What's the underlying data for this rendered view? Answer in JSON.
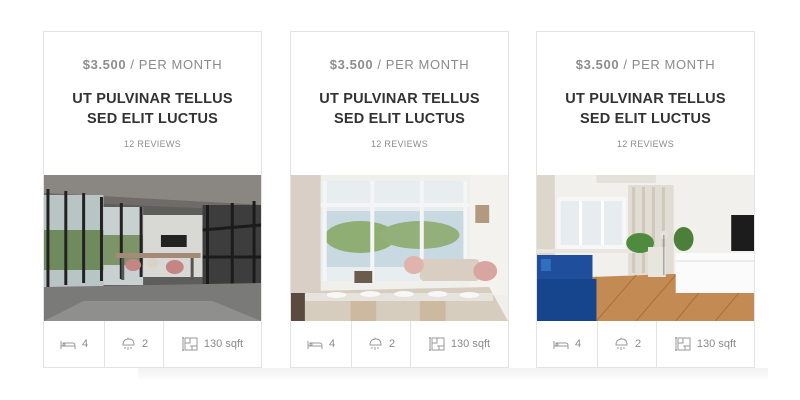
{
  "listings": [
    {
      "price_amount": "$3.500",
      "price_period": " / PER MONTH",
      "title_line1": "UT PULVINAR TELLUS",
      "title_line2": "SED ELIT LUCTUS",
      "reviews": "12 REVIEWS",
      "photo": "loft-office-interior",
      "beds": "4",
      "baths": "2",
      "area": "130 sqft"
    },
    {
      "price_amount": "$3.500",
      "price_period": " / PER MONTH",
      "title_line1": "UT PULVINAR TELLUS",
      "title_line2": "SED ELIT LUCTUS",
      "reviews": "12 REVIEWS",
      "photo": "dining-living-room",
      "beds": "4",
      "baths": "2",
      "area": "130 sqft"
    },
    {
      "price_amount": "$3.500",
      "price_period": " / PER MONTH",
      "title_line1": "UT PULVINAR TELLUS",
      "title_line2": "SED ELIT LUCTUS",
      "reviews": "12 REVIEWS",
      "photo": "living-room-blue-sofa",
      "beds": "4",
      "baths": "2",
      "area": "130 sqft"
    }
  ],
  "icons": {
    "beds": "bed-icon",
    "baths": "shower-icon",
    "area": "floor-plan-icon"
  }
}
